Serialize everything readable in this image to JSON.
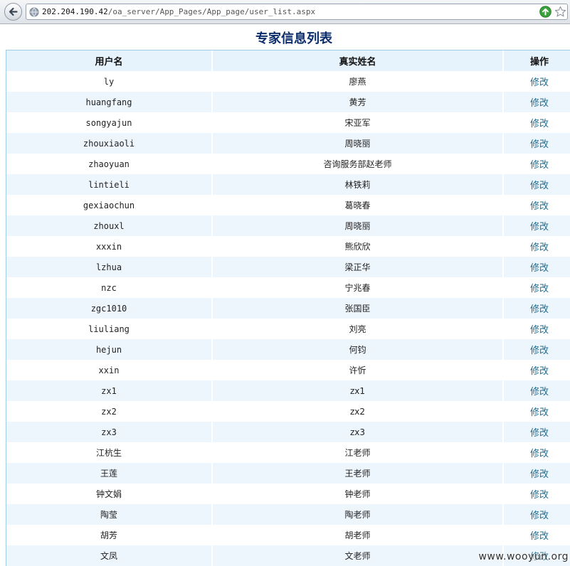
{
  "browser": {
    "url_host": "202.204.190.42",
    "url_path": "/oa_server/App_Pages/App_page/user_list.aspx"
  },
  "page": {
    "title": "专家信息列表"
  },
  "table": {
    "headers": {
      "username": "用户名",
      "realname": "真实姓名",
      "action": "操作"
    },
    "action_label": "修改",
    "rows": [
      {
        "username": "ly",
        "realname": "廖燕"
      },
      {
        "username": "huangfang",
        "realname": "黄芳"
      },
      {
        "username": "songyajun",
        "realname": "宋亚军"
      },
      {
        "username": "zhouxiaoli",
        "realname": "周晓丽"
      },
      {
        "username": "zhaoyuan",
        "realname": "咨询服务部赵老师"
      },
      {
        "username": "lintieli",
        "realname": "林铁莉"
      },
      {
        "username": "gexiaochun",
        "realname": "葛晓春"
      },
      {
        "username": "zhouxl",
        "realname": "周晓丽"
      },
      {
        "username": "xxxin",
        "realname": "熊欣欣"
      },
      {
        "username": "lzhua",
        "realname": "梁正华"
      },
      {
        "username": "nzc",
        "realname": "宁兆春"
      },
      {
        "username": "zgc1010",
        "realname": "张国臣"
      },
      {
        "username": "liuliang",
        "realname": "刘亮"
      },
      {
        "username": "hejun",
        "realname": "何钧"
      },
      {
        "username": "xxin",
        "realname": "许忻"
      },
      {
        "username": "zx1",
        "realname": "zx1"
      },
      {
        "username": "zx2",
        "realname": "zx2"
      },
      {
        "username": "zx3",
        "realname": "zx3"
      },
      {
        "username": "江杭生",
        "realname": "江老师"
      },
      {
        "username": "王莲",
        "realname": "王老师"
      },
      {
        "username": "钟文娟",
        "realname": "钟老师"
      },
      {
        "username": "陶莹",
        "realname": "陶老师"
      },
      {
        "username": "胡芳",
        "realname": "胡老师"
      },
      {
        "username": "文凤",
        "realname": "文老师"
      }
    ]
  },
  "watermark": "www.wooyun.org",
  "colors": {
    "title": "#0b2d6b",
    "link": "#1f6c8f",
    "header_bg": "#e7f3fc",
    "stripe_bg": "#eef6fd",
    "border": "#9ecbe6"
  },
  "icons": [
    "back-arrow-icon",
    "globe-icon",
    "go-arrow-icon",
    "bookmark-star-icon"
  ]
}
